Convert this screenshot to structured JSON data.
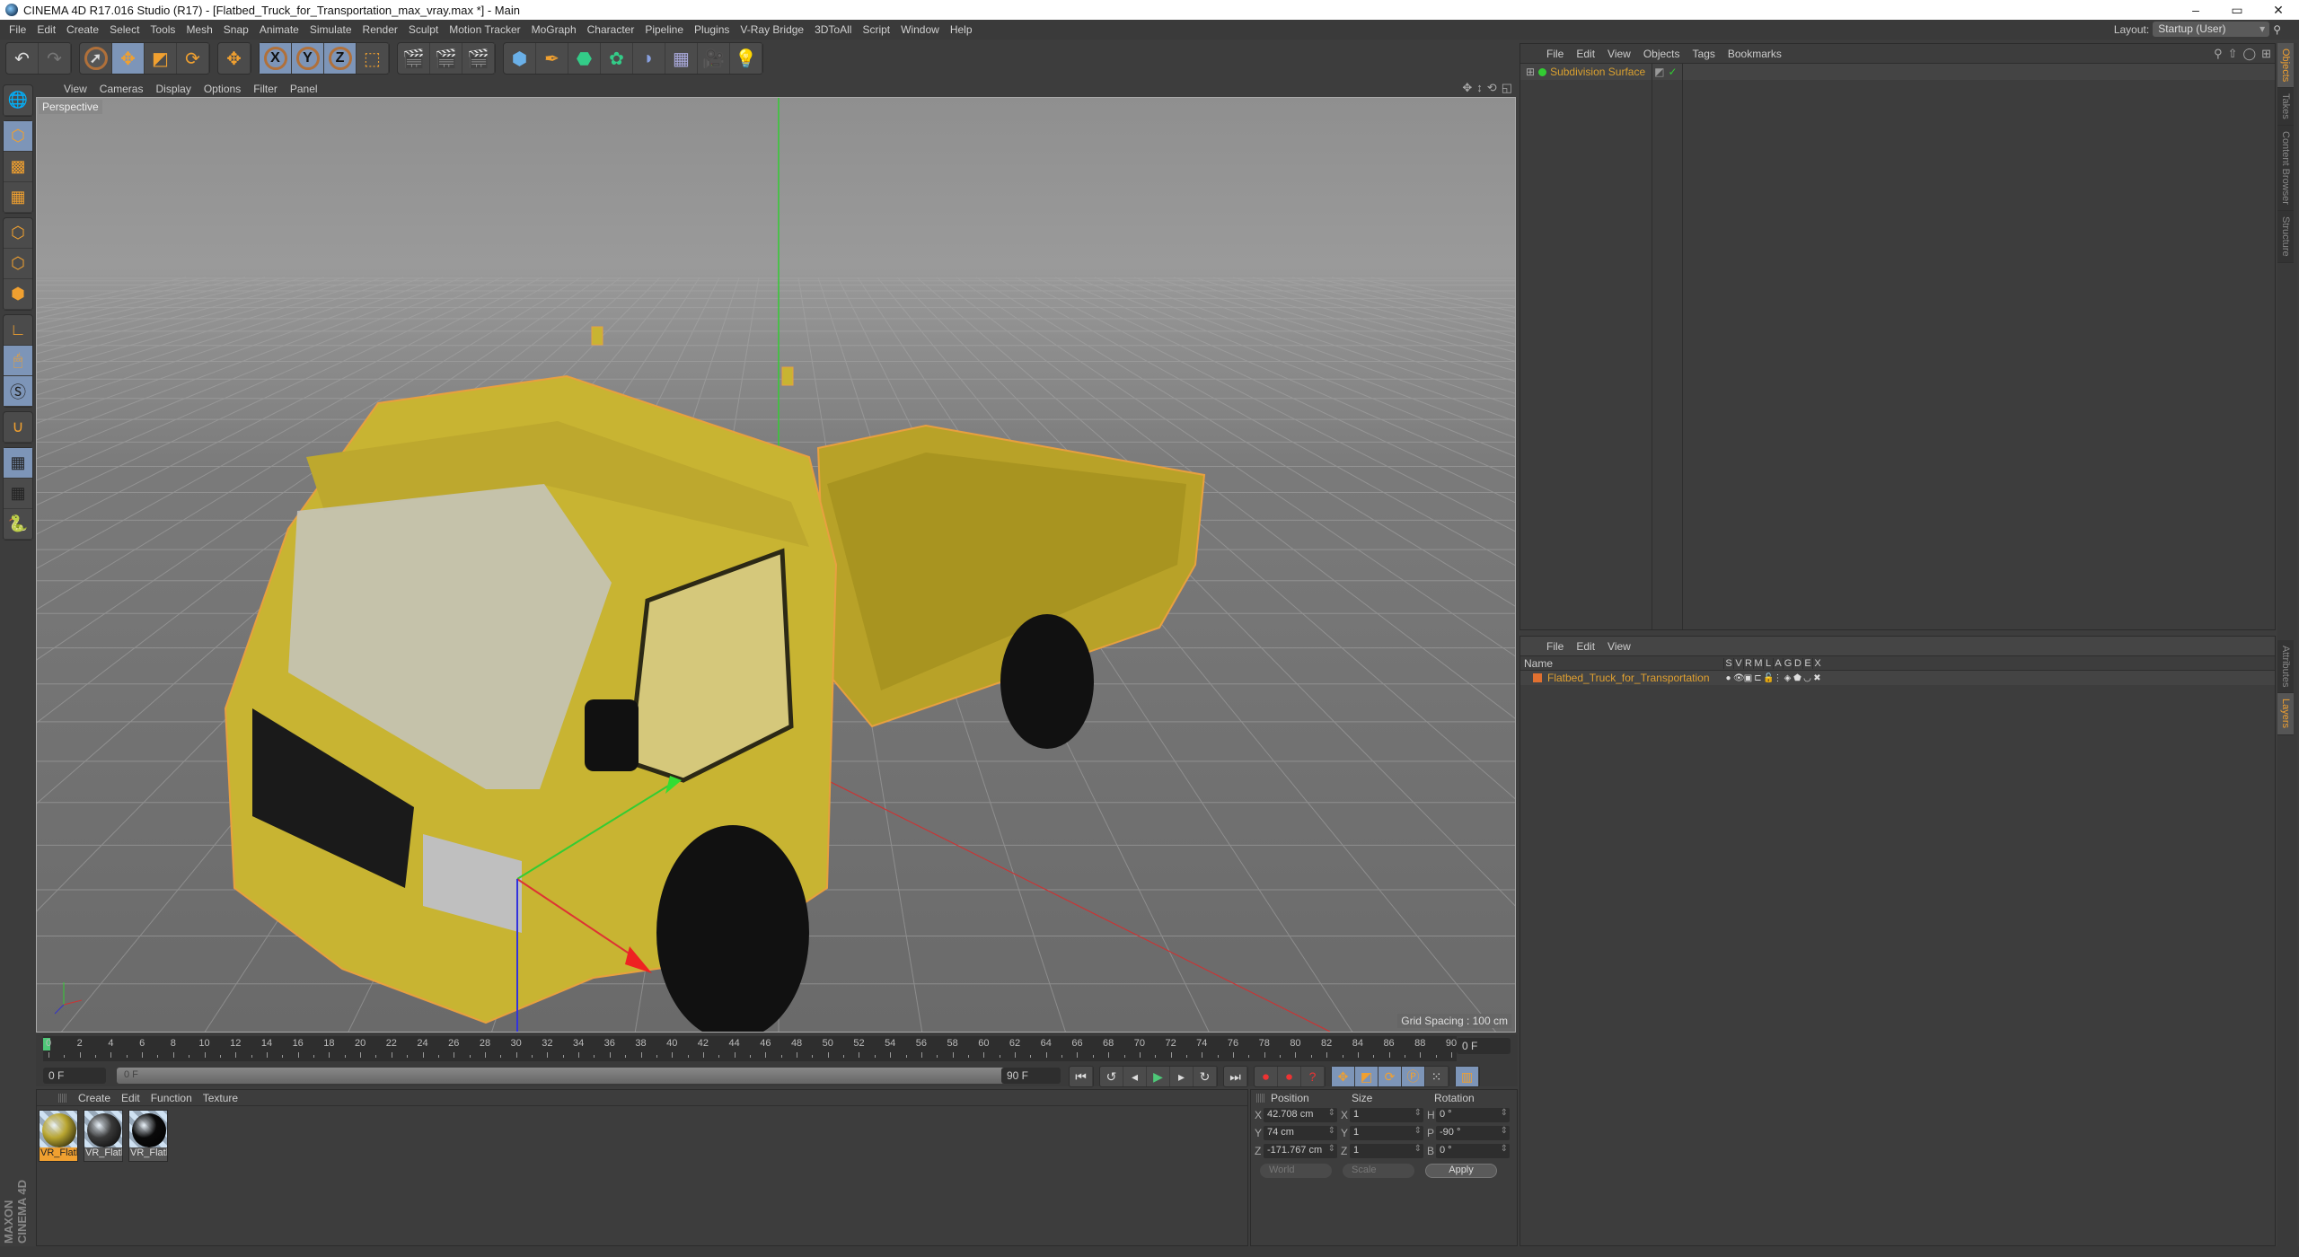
{
  "window": {
    "title": "CINEMA 4D R17.016 Studio (R17) - [Flatbed_Truck_for_Transportation_max_vray.max *] - Main",
    "minimize": "–",
    "maximize": "▭",
    "close": "✕"
  },
  "menubar": [
    "File",
    "Edit",
    "Create",
    "Select",
    "Tools",
    "Mesh",
    "Snap",
    "Animate",
    "Simulate",
    "Render",
    "Sculpt",
    "Motion Tracker",
    "MoGraph",
    "Character",
    "Pipeline",
    "Plugins",
    "V-Ray Bridge",
    "3DToAll",
    "Script",
    "Window",
    "Help"
  ],
  "layout": {
    "label": "Layout:",
    "value": "Startup (User)"
  },
  "toolbar": {
    "undo": "↶",
    "redo": "↷",
    "axis_x": "X",
    "axis_y": "Y",
    "axis_z": "Z"
  },
  "viewport": {
    "menu": [
      "View",
      "Cameras",
      "Display",
      "Options",
      "Filter",
      "Panel"
    ],
    "label": "Perspective",
    "grid_spacing": "Grid Spacing : 100 cm"
  },
  "timeline": {
    "ticks": [
      0,
      2,
      4,
      6,
      8,
      10,
      12,
      14,
      16,
      18,
      20,
      22,
      24,
      26,
      28,
      30,
      32,
      34,
      36,
      38,
      40,
      42,
      44,
      46,
      48,
      50,
      52,
      54,
      56,
      58,
      60,
      62,
      64,
      66,
      68,
      70,
      72,
      74,
      76,
      78,
      80,
      82,
      84,
      86,
      88,
      90
    ],
    "current_frame": "0 F",
    "start_field": "0 F",
    "range_start": "0 F",
    "range_end": "90 F",
    "end_field": "90 F"
  },
  "materials": {
    "menu": [
      "Create",
      "Edit",
      "Function",
      "Texture"
    ],
    "items": [
      {
        "label": "VR_Flatl",
        "selected": true,
        "color": "#b8a530"
      },
      {
        "label": "VR_Flatl",
        "selected": false,
        "color": "#3a3a3a"
      },
      {
        "label": "VR_Flatl",
        "selected": false,
        "color": "#0a0a0a"
      }
    ]
  },
  "coordinates": {
    "headers": {
      "position": "Position",
      "size": "Size",
      "rotation": "Rotation"
    },
    "rows": [
      {
        "axis": "X",
        "position": "42.708 cm",
        "size_axis": "X",
        "size": "1",
        "rot_axis": "H",
        "rotation": "0 °"
      },
      {
        "axis": "Y",
        "position": "74 cm",
        "size_axis": "Y",
        "size": "1",
        "rot_axis": "P",
        "rotation": "-90 °"
      },
      {
        "axis": "Z",
        "position": "-171.767 cm",
        "size_axis": "Z",
        "size": "1",
        "rot_axis": "B",
        "rotation": "0 °"
      }
    ],
    "mode": "World",
    "scale_mode": "Scale",
    "apply": "Apply"
  },
  "object_manager": {
    "menu": [
      "File",
      "Edit",
      "View",
      "Objects",
      "Tags",
      "Bookmarks"
    ],
    "objects": [
      {
        "name": "Subdivision Surface"
      }
    ]
  },
  "layer_manager": {
    "menu": [
      "File",
      "Edit",
      "View"
    ],
    "columns": [
      "Name",
      "S",
      "V",
      "R",
      "M",
      "L",
      "A",
      "G",
      "D",
      "E",
      "X"
    ],
    "layers": [
      {
        "name": "Flatbed_Truck_for_Transportation",
        "color": "#e07030"
      }
    ]
  },
  "side_tabs_top": [
    "Objects",
    "Takes",
    "Content Browser",
    "Structure"
  ],
  "side_tabs_bottom": [
    "Attributes",
    "Layers"
  ],
  "branding": "MAXON CINEMA 4D",
  "colors": {
    "accent": "#f0a030",
    "selected_tool": "#7d95b8",
    "truck": "#c8b432"
  }
}
